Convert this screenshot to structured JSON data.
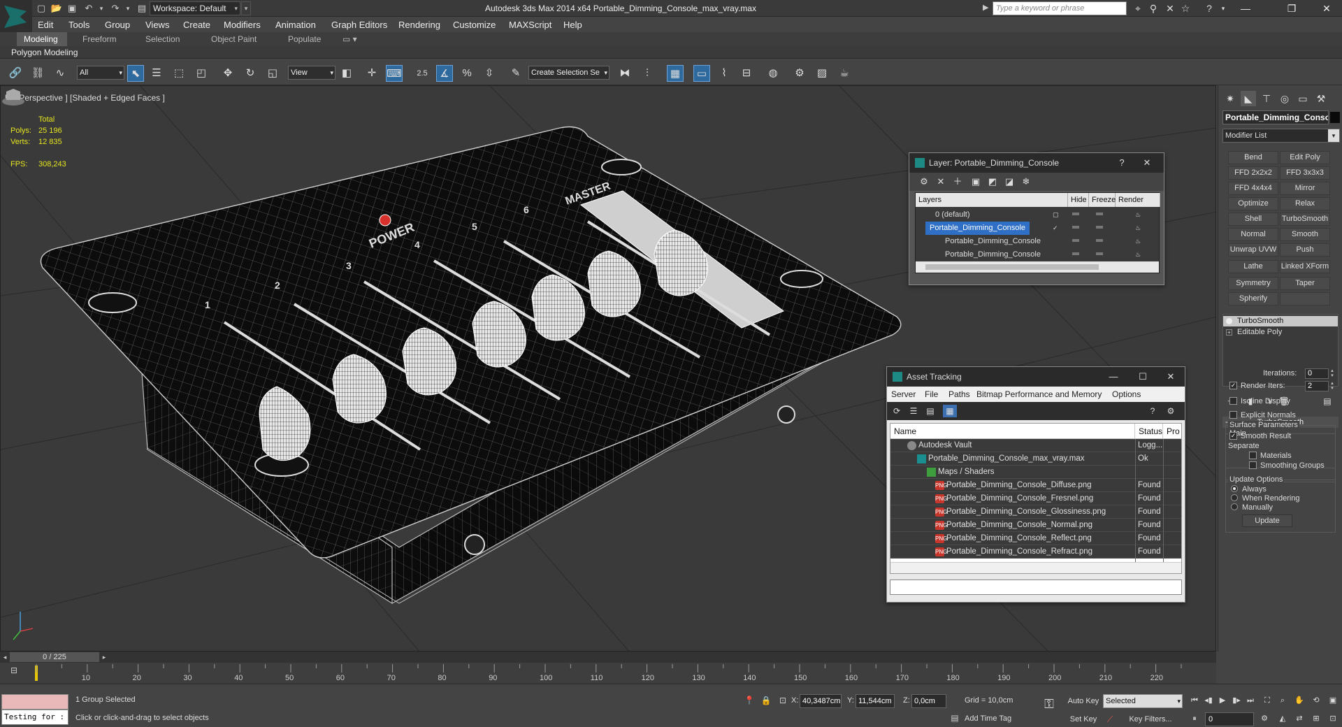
{
  "app": {
    "window_title": "Autodesk 3ds Max  2014 x64    Portable_Dimming_Console_max_vray.max",
    "workspace": "Workspace: Default",
    "search_placeholder": "Type a keyword or phrase"
  },
  "menu": [
    "Edit",
    "Tools",
    "Group",
    "Views",
    "Create",
    "Modifiers",
    "Animation",
    "Graph Editors",
    "Rendering",
    "Customize",
    "MAXScript",
    "Help"
  ],
  "ribbon": {
    "tabs": [
      "Modeling",
      "Freeform",
      "Selection",
      "Object Paint",
      "Populate"
    ],
    "active_tab": "Modeling",
    "sub_label": "Polygon Modeling"
  },
  "toolbar": {
    "filter": "All",
    "ref_coord": "View",
    "snap_value": "2.5",
    "named_selection": "Create Selection Se"
  },
  "viewport": {
    "label": "[+] [Perspective ] [Shaded + Edged Faces ]",
    "stats": {
      "total_label": "Total",
      "polys_label": "Polys:",
      "polys": "25 196",
      "verts_label": "Verts:",
      "verts": "12 835",
      "fps_label": "FPS:",
      "fps": "308,243"
    },
    "console_labels": {
      "power": "POWER",
      "master": "MASTER",
      "channels": [
        "1",
        "2",
        "3",
        "4",
        "5",
        "6"
      ]
    }
  },
  "layer_dialog": {
    "title": "Layer: Portable_Dimming_Console",
    "columns": [
      "Layers",
      "Hide",
      "Freeze",
      "Render"
    ],
    "rows": [
      {
        "name": "0 (default)",
        "selected": false
      },
      {
        "name": "Portable_Dimming_Console",
        "selected": true
      },
      {
        "name": "Portable_Dimming_Console",
        "selected": false
      },
      {
        "name": "Portable_Dimming_Console",
        "selected": false
      }
    ]
  },
  "asset_dialog": {
    "title": "Asset Tracking",
    "menu": [
      "Server",
      "File",
      "Paths",
      "Bitmap Performance and Memory",
      "Options"
    ],
    "columns": [
      "Name",
      "Status",
      "Pro"
    ],
    "rows": [
      {
        "name": "Autodesk Vault",
        "status": "Logg...",
        "kind": "vault"
      },
      {
        "name": "Portable_Dimming_Console_max_vray.max",
        "status": "Ok",
        "kind": "max"
      },
      {
        "name": "Maps / Shaders",
        "status": "",
        "kind": "map"
      },
      {
        "name": "Portable_Dimming_Console_Diffuse.png",
        "status": "Found",
        "kind": "png"
      },
      {
        "name": "Portable_Dimming_Console_Fresnel.png",
        "status": "Found",
        "kind": "png"
      },
      {
        "name": "Portable_Dimming_Console_Glossiness.png",
        "status": "Found",
        "kind": "png"
      },
      {
        "name": "Portable_Dimming_Console_Normal.png",
        "status": "Found",
        "kind": "png"
      },
      {
        "name": "Portable_Dimming_Console_Reflect.png",
        "status": "Found",
        "kind": "png"
      },
      {
        "name": "Portable_Dimming_Console_Refract.png",
        "status": "Found",
        "kind": "png"
      }
    ]
  },
  "command_panel": {
    "object_name": "Portable_Dimming_Console",
    "modifier_list": "Modifier List",
    "modifier_buttons": [
      "Bend",
      "Edit Poly",
      "FFD 2x2x2",
      "FFD 3x3x3",
      "FFD 4x4x4",
      "Mirror",
      "Optimize",
      "Relax",
      "Shell",
      "TurboSmooth",
      "Normal",
      "Smooth",
      "Unwrap UVW",
      "Push",
      "Lathe",
      "Linked XForm",
      "Symmetry",
      "Taper",
      "Spherify",
      ""
    ],
    "stack": [
      "TurboSmooth",
      "Editable Poly"
    ],
    "turbosmooth": {
      "rollout": "TurboSmooth",
      "main": "Main",
      "iterations_label": "Iterations:",
      "iterations": "0",
      "render_iters_label": "Render Iters:",
      "render_iters": "2",
      "isoline": "Isoline Display",
      "explicit_normals": "Explicit Normals",
      "surface_params": "Surface Parameters",
      "smooth_result": "Smooth Result",
      "separate": "Separate",
      "materials": "Materials",
      "smoothing_groups": "Smoothing Groups",
      "update_options": "Update Options",
      "always": "Always",
      "when_rendering": "When Rendering",
      "manually": "Manually",
      "update": "Update"
    }
  },
  "timeline": {
    "frame": "0 / 225",
    "ticks": [
      "10",
      "20",
      "30",
      "40",
      "50",
      "60",
      "70",
      "80",
      "90",
      "100",
      "110",
      "120",
      "130",
      "140",
      "150",
      "160",
      "170",
      "180",
      "190",
      "200",
      "210",
      "220"
    ]
  },
  "status": {
    "listener": "Testing for :",
    "selection": "1 Group Selected",
    "prompt": "Click or click-and-drag to select objects",
    "x_label": "X:",
    "x": "40,3487cm",
    "y_label": "Y:",
    "y": "11,544cm",
    "z_label": "Z:",
    "z": "0,0cm",
    "grid": "Grid = 10,0cm",
    "add_time_tag": "Add Time Tag",
    "auto_key": "Auto Key",
    "set_key": "Set Key",
    "key_mode": "Selected",
    "key_filters": "Key Filters...",
    "current_frame": "0"
  },
  "colors": {
    "accent": "#2f6fc6",
    "brand": "#1d8a84",
    "png_icon": "#c8352b"
  }
}
